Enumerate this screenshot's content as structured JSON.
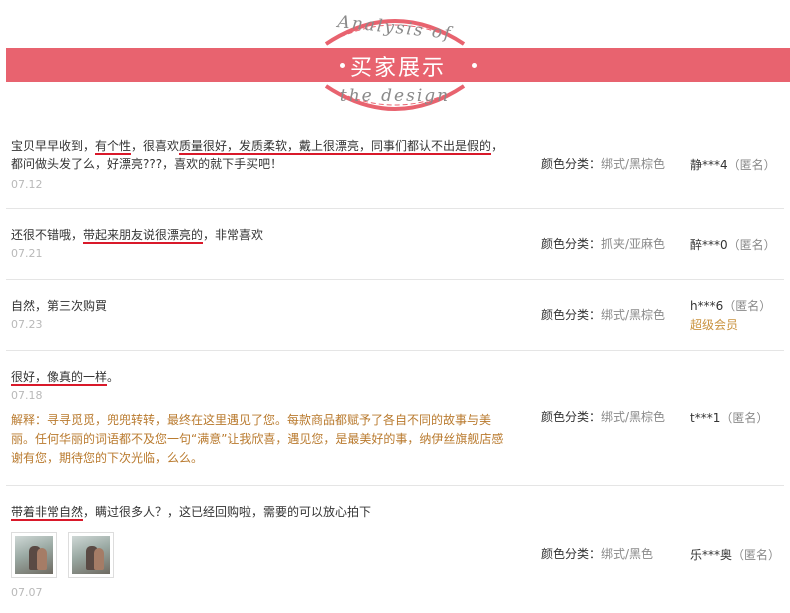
{
  "header": {
    "top_arc_text": "Analysis of",
    "banner_title": "买家展示",
    "bottom_arc_text": "the design",
    "accent": "#e8636f"
  },
  "reviews": [
    {
      "segments": [
        {
          "t": "宝贝早早收到，",
          "u": false
        },
        {
          "t": "有个性",
          "u": true
        },
        {
          "t": "，很喜欢",
          "u": false
        },
        {
          "t": "质量很好，发质柔软，戴上很漂亮，同事们都认不出是假的",
          "u": true
        },
        {
          "t": "，都问做头发了么，好漂亮???，喜欢的就下手买吧！",
          "u": false
        }
      ],
      "date": "07.12",
      "color_label": "颜色分类：",
      "color_value": "绑式/黑棕色",
      "user": "静***4",
      "anon": "（匿名）"
    },
    {
      "segments": [
        {
          "t": "还很不错哦，",
          "u": false
        },
        {
          "t": "带起来朋友说很漂亮的",
          "u": true
        },
        {
          "t": "，非常喜欢",
          "u": false
        }
      ],
      "date": "07.21",
      "color_label": "颜色分类：",
      "color_value": "抓夹/亚麻色",
      "user": "醉***0",
      "anon": "（匿名）"
    },
    {
      "segments": [
        {
          "t": "自然，第三次购買",
          "u": false
        }
      ],
      "date": "07.23",
      "color_label": "颜色分类：",
      "color_value": "绑式/黑棕色",
      "user": "h***6",
      "anon": "（匿名）",
      "vip": "超级会员"
    },
    {
      "segments": [
        {
          "t": "很好，像真的一样",
          "u": true
        },
        {
          "t": "。",
          "u": false
        }
      ],
      "date": "07.18",
      "reply": "解释：寻寻觅觅，兜兜转转，最终在这里遇见了您。每款商品都赋予了各自不同的故事与美丽。任何华丽的词语都不及您一句“满意”让我欣喜，遇见您，是最美好的事，纳伊丝旗舰店感谢有您，期待您的下次光临，么么。",
      "color_label": "颜色分类：",
      "color_value": "绑式/黑棕色",
      "user": "t***1",
      "anon": "（匿名）"
    },
    {
      "segments": [
        {
          "t": "带着非常自然",
          "u": true
        },
        {
          "t": "，瞒过很多人？，这已经回购啦，需要的可以放心拍下",
          "u": false
        }
      ],
      "photos": [
        "review-photo-1",
        "review-photo-2"
      ],
      "date": "07.07",
      "color_label": "颜色分类：",
      "color_value": "绑式/黑色",
      "user": "乐***奥",
      "anon": "（匿名）"
    }
  ]
}
